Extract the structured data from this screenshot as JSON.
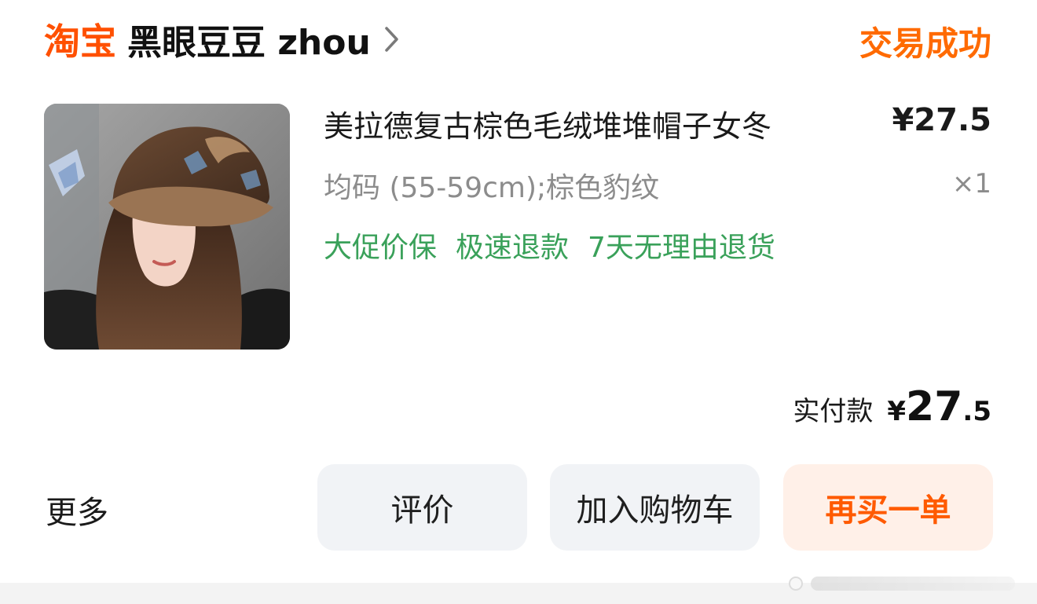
{
  "header": {
    "brand": "淘宝",
    "shop_name": "黑眼豆豆 zhou",
    "status": "交易成功"
  },
  "product": {
    "image_icon": "product-photo-hat",
    "title": "美拉德复古棕色毛绒堆堆帽子女冬",
    "price": "¥27.5",
    "sku": "均码 (55-59cm);棕色豹纹",
    "quantity": "×1",
    "services": [
      "大促价保",
      "极速退款",
      "7天无理由退货"
    ]
  },
  "payment": {
    "label": "实付款",
    "currency": "¥",
    "amount_int": "27",
    "amount_dec": ".5"
  },
  "actions": {
    "more_label": "更多",
    "review_label": "评价",
    "cart_label": "加入购物车",
    "rebuy_label": "再买一单"
  },
  "colors": {
    "brand_orange": "#ff5000",
    "status_orange": "#ff6a00",
    "service_green": "#3aa15a",
    "rebuy_bg": "#fff0e8"
  }
}
